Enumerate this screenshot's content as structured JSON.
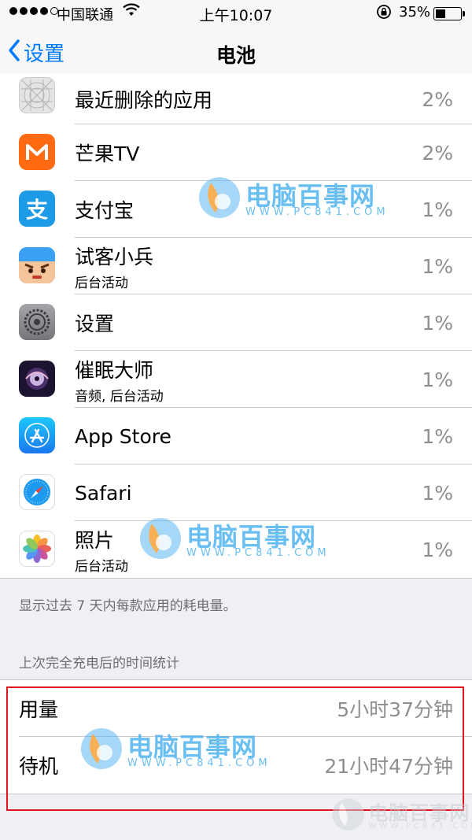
{
  "status_bar": {
    "carrier": "中国联通",
    "time": "上午10:07",
    "battery_percent": "35%",
    "battery_level": 0.35,
    "signal_bars": 4,
    "signal_total": 5
  },
  "nav": {
    "back_label": "设置",
    "title": "电池"
  },
  "apps": [
    {
      "name": "最近删除的应用",
      "sub": "",
      "percent": "2%",
      "icon": "deleted-apps-icon",
      "color": "#d9d9d9"
    },
    {
      "name": "芒果TV",
      "sub": "",
      "percent": "2%",
      "icon": "mango-tv-icon",
      "color": "#ff6a13"
    },
    {
      "name": "支付宝",
      "sub": "",
      "percent": "1%",
      "icon": "alipay-icon",
      "color": "#1e9be7"
    },
    {
      "name": "试客小兵",
      "sub": "后台活动",
      "percent": "1%",
      "icon": "shike-xiaobing-icon",
      "color": "#3aa0f2"
    },
    {
      "name": "设置",
      "sub": "",
      "percent": "1%",
      "icon": "settings-icon",
      "color": "#8e8e93"
    },
    {
      "name": "催眠大师",
      "sub": "音频, 后台活动",
      "percent": "1%",
      "icon": "hypnosis-master-icon",
      "color": "#1c1330"
    },
    {
      "name": "App Store",
      "sub": "",
      "percent": "1%",
      "icon": "app-store-icon",
      "color": "#1a8cf0"
    },
    {
      "name": "Safari",
      "sub": "",
      "percent": "1%",
      "icon": "safari-icon",
      "color": "#ffffff"
    },
    {
      "name": "照片",
      "sub": "后台活动",
      "percent": "1%",
      "icon": "photos-icon",
      "color": "#ffffff"
    }
  ],
  "footer_note": "显示过去 7 天内每款应用的耗电量。",
  "section_header": "上次完全充电后的时间统计",
  "usage": {
    "usage_label": "用量",
    "usage_value": "5小时37分钟",
    "standby_label": "待机",
    "standby_value": "21小时47分钟"
  },
  "watermark": {
    "name": "电脑百事网",
    "url": "WWW.PC841.COM"
  },
  "colors": {
    "accent": "#007aff",
    "highlight": "#e0141e",
    "watermark": "#4fb3f0"
  }
}
